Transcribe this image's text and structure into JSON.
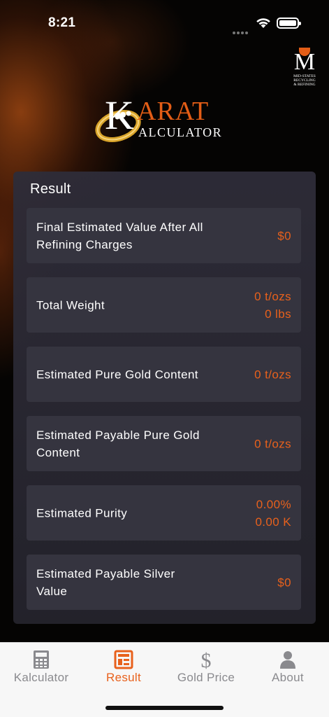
{
  "status_bar": {
    "time": "8:21"
  },
  "brand": {
    "ms_logo_letter": "M",
    "ms_logo_tagline": [
      "MID-STATES",
      "RECYCLING",
      "& REFINING"
    ],
    "app_logo_k": "K",
    "app_logo_arat": "ARAT",
    "app_logo_alculator": "ALCULATOR",
    "accent_color": "#e8611c"
  },
  "result": {
    "title": "Result",
    "rows": [
      {
        "label": "Final Estimated Value After All Refining Charges",
        "values": [
          "$0"
        ]
      },
      {
        "label": "Total Weight",
        "values": [
          "0 t/ozs",
          "0 lbs"
        ]
      },
      {
        "label": "Estimated Pure Gold Content",
        "values": [
          "0 t/ozs"
        ]
      },
      {
        "label": "Estimated Payable Pure Gold Content",
        "values": [
          "0 t/ozs"
        ]
      },
      {
        "label": "Estimated Purity",
        "values": [
          "0.00%",
          "0.00 K"
        ]
      },
      {
        "label": "Estimated Payable Silver Value",
        "values": [
          "$0"
        ]
      }
    ]
  },
  "tabbar": {
    "tabs": [
      {
        "label": "Kalculator",
        "icon": "calculator-icon",
        "active": false
      },
      {
        "label": "Result",
        "icon": "result-icon",
        "active": true
      },
      {
        "label": "Gold Price",
        "icon": "dollar-icon",
        "active": false
      },
      {
        "label": "About",
        "icon": "person-icon",
        "active": false
      }
    ]
  }
}
